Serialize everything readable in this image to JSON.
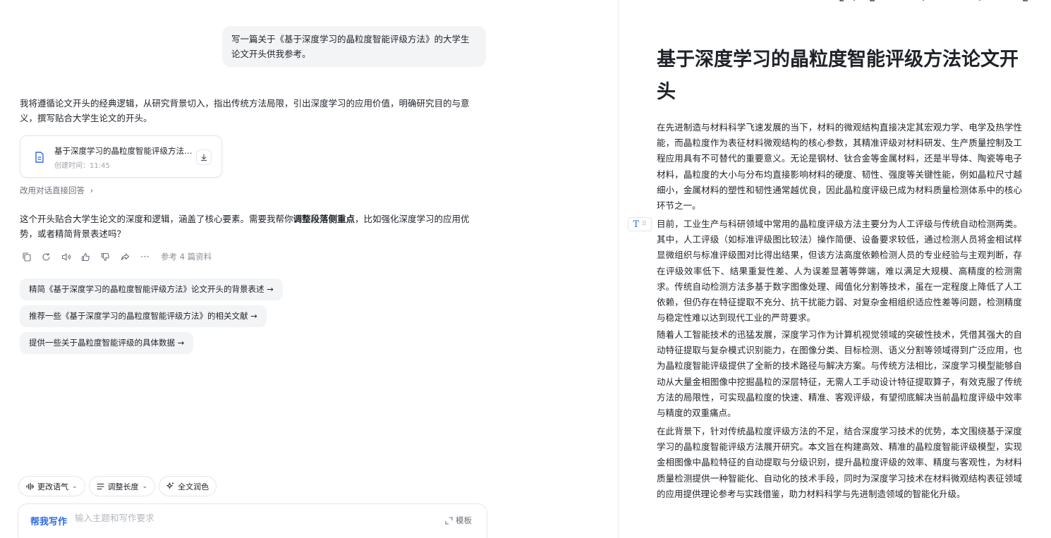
{
  "chat": {
    "user_message": "写一篇关于《基于深度学习的晶粒度智能评级方法》的大学生论文开头供我参考。",
    "reply_intro": "我将遵循论文开头的经典逻辑，从研究背景切入，指出传统方法局限，引出深度学习的应用价值，明确研究目的与意义，撰写贴合大学生论文的开头。",
    "doc_card": {
      "title": "基于深度学习的晶粒度智能评级方法论文开头",
      "created": "创建时间：11:45"
    },
    "switch_link": "改用对话直接回答",
    "reply_follow": {
      "before": "这个开头贴合大学生论文的深度和逻辑，涵盖了核心要素。需要我帮你",
      "bold": "调整段落侧重点",
      "after": "，比如强化深度学习的应用优势，或者精简背景表述吗？"
    },
    "references": "参考 4 篇资料",
    "suggestions": [
      "精简《基于深度学习的晶粒度智能评级方法》论文开头的背景表述 →",
      "推荐一些《基于深度学习的晶粒度智能评级方法》的相关文献 →",
      "提供一些关于晶粒度智能评级的具体数据 →"
    ],
    "tools": [
      "更改语气",
      "调整长度",
      "全文润色"
    ],
    "composer": {
      "mode": "帮我写作",
      "placeholder": "输入主题和写作要求",
      "template": "模板"
    }
  },
  "document": {
    "heading": "基于深度学习的晶粒度智能评级方法论文开头",
    "paragraphs": [
      "在先进制造与材料科学飞速发展的当下，材料的微观结构直接决定其宏观力学、电学及热学性能，而晶粒度作为表征材料微观结构的核心参数，其精准评级对材料研发、生产质量控制及工程应用具有不可替代的重要意义。无论是钢材、钛合金等金属材料，还是半导体、陶瓷等电子材料，晶粒度的大小与分布均直接影响材料的硬度、韧性、强度等关键性能，例如晶粒尺寸越细小，金属材料的塑性和韧性通常越优良，因此晶粒度评级已成为材料质量检测体系中的核心环节之一。",
      "目前，工业生产与科研领域中常用的晶粒度评级方法主要分为人工评级与传统自动检测两类。其中，人工评级（如标准评级图比较法）操作简便、设备要求较低，通过检测人员将金相试样显微组织与标准评级图对比得出结果，但该方法高度依赖检测人员的专业经验与主观判断，存在评级效率低下、结果重复性差、人为误差显著等弊端，难以满足大规模、高精度的检测需求。传统自动检测方法多基于数字图像处理、阈值化分割等技术，虽在一定程度上降低了人工依赖，但仍存在特征提取不充分、抗干扰能力弱、对复杂金相组织适应性差等问题，检测精度与稳定性难以达到现代工业的严苛要求。",
      "随着人工智能技术的迅猛发展，深度学习作为计算机视觉领域的突破性技术，凭借其强大的自动特征提取与复杂模式识别能力，在图像分类、目标检测、语义分割等领域得到广泛应用，也为晶粒度智能评级提供了全新的技术路径与解决方案。与传统方法相比，深度学习模型能够自动从大量金相图像中挖掘晶粒的深层特征，无需人工手动设计特征提取算子，有效克服了传统方法的局限性，可实现晶粒度的快速、精准、客观评级，有望彻底解决当前晶粒度评级中效率与精度的双重痛点。",
      "在此背景下，针对传统晶粒度评级方法的不足，结合深度学习技术的优势，本文围绕基于深度学习的晶粒度智能评级方法展开研究。本文旨在构建高效、精准的晶粒度智能评级模型，实现金相图像中晶粒特征的自动提取与分级识别，提升晶粒度评级的效率、精度与客观性，为材料质量检测提供一种智能化、自动化的技术手段，同时为深度学习技术在材料微观结构表征领域的应用提供理论参考与实践借鉴，助力材料科学与先进制造领域的智能化升级。"
    ]
  },
  "colors": {
    "accent": "#2b6be6",
    "bubble": "#f3f4f6",
    "border": "#e5e6eb"
  }
}
